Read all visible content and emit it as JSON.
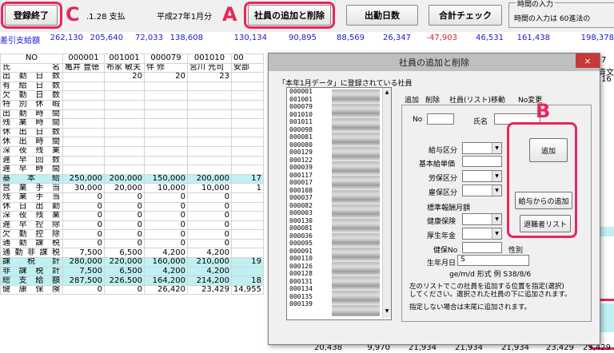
{
  "toolbar": {
    "finish_label": "登録終了",
    "date_label": ".1.28 支払",
    "month_label": "平成27年1月分",
    "add_delete_label": "社員の追加と削除",
    "attendance_label": "出勤日数",
    "total_check_label": "合計チェック",
    "time_input_group": "時間の入力",
    "time_input_note": "時間の入力は 60進法の"
  },
  "callouts": {
    "a": "A",
    "b": "B",
    "c": "C"
  },
  "net_row": {
    "label": "差引支給額",
    "values": [
      "262,130",
      "205,640",
      "72,033",
      "138,608",
      "130,134",
      "90,895",
      "88,569",
      "26,347",
      "-47,903",
      "46,531",
      "161,438",
      "198,378"
    ]
  },
  "grid": {
    "header_no": "NO",
    "header_name": "氏　　　　名",
    "ids": [
      "000001",
      "001001",
      "000079",
      "001010",
      "00"
    ],
    "names": [
      "亀井 豊徳",
      "布家 敏夫",
      "伴 修",
      "宮川 光司",
      "安部"
    ],
    "rows": [
      {
        "label": "出勤日数",
        "values": [
          "",
          "20",
          "20",
          "23",
          ""
        ]
      },
      {
        "label": "有給日数",
        "values": [
          "",
          "",
          "",
          "",
          ""
        ]
      },
      {
        "label": "欠勤日数",
        "values": [
          "",
          "",
          "",
          "",
          ""
        ]
      },
      {
        "label": "特別休暇",
        "values": [
          "",
          "",
          "",
          "",
          ""
        ]
      },
      {
        "label": "出勤時間",
        "values": [
          "",
          "",
          "",
          "",
          ""
        ]
      },
      {
        "label": "残業時間",
        "values": [
          "",
          "",
          "",
          "",
          ""
        ]
      },
      {
        "label": "休出日数",
        "values": [
          "",
          "",
          "",
          "",
          ""
        ]
      },
      {
        "label": "休出時間",
        "values": [
          "",
          "",
          "",
          "",
          ""
        ]
      },
      {
        "label": "深夜残業",
        "values": [
          "",
          "",
          "",
          "",
          ""
        ]
      },
      {
        "label": "遅早回数",
        "values": [
          "",
          "",
          "",
          "",
          ""
        ]
      },
      {
        "label": "遅早時間",
        "values": [
          "",
          "",
          "",
          "",
          ""
        ]
      },
      {
        "label": "基本給",
        "values": [
          "250,000",
          "200,000",
          "150,000",
          "200,000",
          "17"
        ],
        "cyan": true
      },
      {
        "label": "営業手当",
        "values": [
          "30,000",
          "20,000",
          "10,000",
          "10,000",
          "1"
        ]
      },
      {
        "label": "残業手当",
        "values": [
          "0",
          "0",
          "0",
          "0",
          ""
        ]
      },
      {
        "label": "休日出勤",
        "values": [
          "0",
          "0",
          "0",
          "0",
          ""
        ]
      },
      {
        "label": "深夜残業",
        "values": [
          "0",
          "0",
          "0",
          "0",
          ""
        ]
      },
      {
        "label": "遅早控除",
        "values": [
          "0",
          "0",
          "0",
          "0",
          ""
        ]
      },
      {
        "label": "欠勤控除",
        "values": [
          "0",
          "0",
          "0",
          "0",
          ""
        ]
      },
      {
        "label": "通勤課税",
        "values": [
          "0",
          "0",
          "0",
          "0",
          ""
        ]
      },
      {
        "label": "通勤非課税",
        "values": [
          "7,500",
          "6,500",
          "4,200",
          "4,200",
          ""
        ]
      },
      {
        "label": "課税計",
        "values": [
          "280,000",
          "220,000",
          "160,000",
          "210,000",
          "19"
        ],
        "cyan": true
      },
      {
        "label": "非課税計",
        "values": [
          "7,500",
          "6,500",
          "4,200",
          "4,200",
          ""
        ],
        "cyan": true
      },
      {
        "label": "総支給額",
        "values": [
          "287,500",
          "226,500",
          "164,200",
          "214,200",
          "18"
        ],
        "cyan": true
      },
      {
        "label": "健康保険",
        "values": [
          "0",
          "0",
          "26,420",
          "23,429",
          "14,955"
        ]
      }
    ],
    "last_row_right": [
      "20,438",
      "9,970",
      "21,934",
      "21,934",
      "21,934",
      "23,429",
      "23,429"
    ],
    "right_edge": {
      "col_num": "7",
      "col_name": "貞文",
      "val": "16"
    }
  },
  "dialog": {
    "title": "社員の追加と削除",
    "close": "×",
    "list_caption": "「本年1月データ」に登録されている社員",
    "list_items": [
      "000001",
      "001001",
      "000079",
      "001010",
      "001011",
      "000098",
      "000081",
      "000080",
      "000129",
      "000122",
      "000039",
      "000117",
      "000017",
      "000108",
      "000037",
      "000082",
      "000003",
      "000130",
      "000081",
      "000036",
      "000095",
      "000091",
      "000110",
      "000126",
      "000128",
      "000131",
      "000134",
      "000135",
      "000139"
    ],
    "tabs": [
      "追加",
      "削除",
      "社員(リスト)移動",
      "No変更"
    ],
    "no_label": "No",
    "name_label": "氏名",
    "salary_type": "給与区分",
    "base_rate": "基本給単価",
    "labor_type": "労保区分",
    "employ_type": "雇保区分",
    "std_pay": "標準報酬月額",
    "health_ins": "健康保険",
    "pension": "厚生年金",
    "health_no": "健保No",
    "gender": "性別",
    "birth": "生年月日",
    "birth_value": "S",
    "birth_format": "ge/m/d 形式 例 S38/8/6",
    "add_btn": "追加",
    "from_pay_btn": "給与からの追加",
    "retired_btn": "退職者リスト",
    "note1": "左のリストでこの社員を追加する位置を指定(選択)",
    "note2": "してください。選択された社員の下に追加されます。",
    "note3": "指定しない場合は末尾に追加されます。"
  }
}
